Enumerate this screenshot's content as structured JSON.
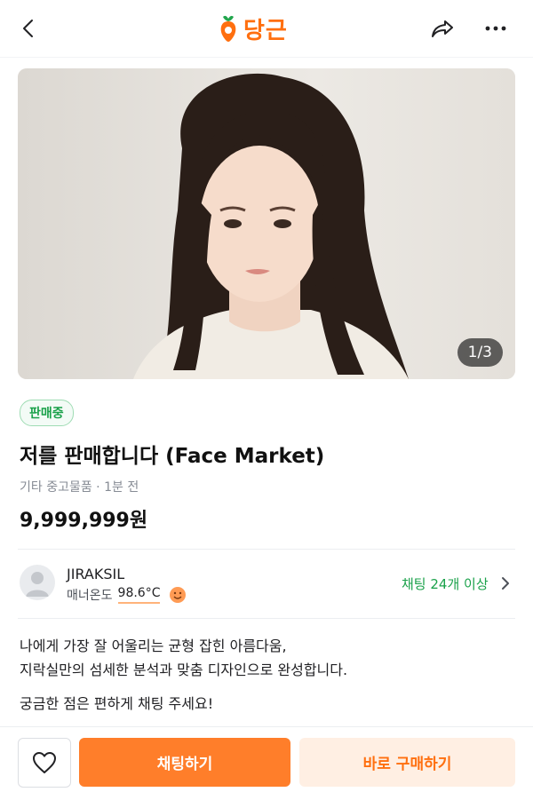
{
  "header": {
    "logo_text": "당근",
    "back_icon": "chevron-left-icon",
    "share_icon": "share-icon",
    "more_icon": "more-horizontal-icon",
    "brand_color": "#ff6f0f"
  },
  "product": {
    "image_counter": "1/3",
    "status": "판매중",
    "title": "저를 판매합니다 (Face Market)",
    "meta": "기타 중고물품 · 1분 전",
    "price": "9,999,999원"
  },
  "seller": {
    "name": "JIRAKSIL",
    "manner_label": "매너온도",
    "temperature": "98.6°C",
    "chat_count": "채팅 24개 이상"
  },
  "description": {
    "line1": "나에게 가장 잘 어울리는 균형 잡힌 아름다움,",
    "line2": "지락실만의 섬세한 분석과 맞춤 디자인으로 완성합니다.",
    "line3": "궁금한 점은 편하게 채팅 주세요!"
  },
  "actions": {
    "like_icon": "heart-icon",
    "chat_label": "채팅하기",
    "buy_label": "바로 구매하기",
    "accent_color": "#ff7e2a",
    "status_color": "#1aa14a"
  }
}
